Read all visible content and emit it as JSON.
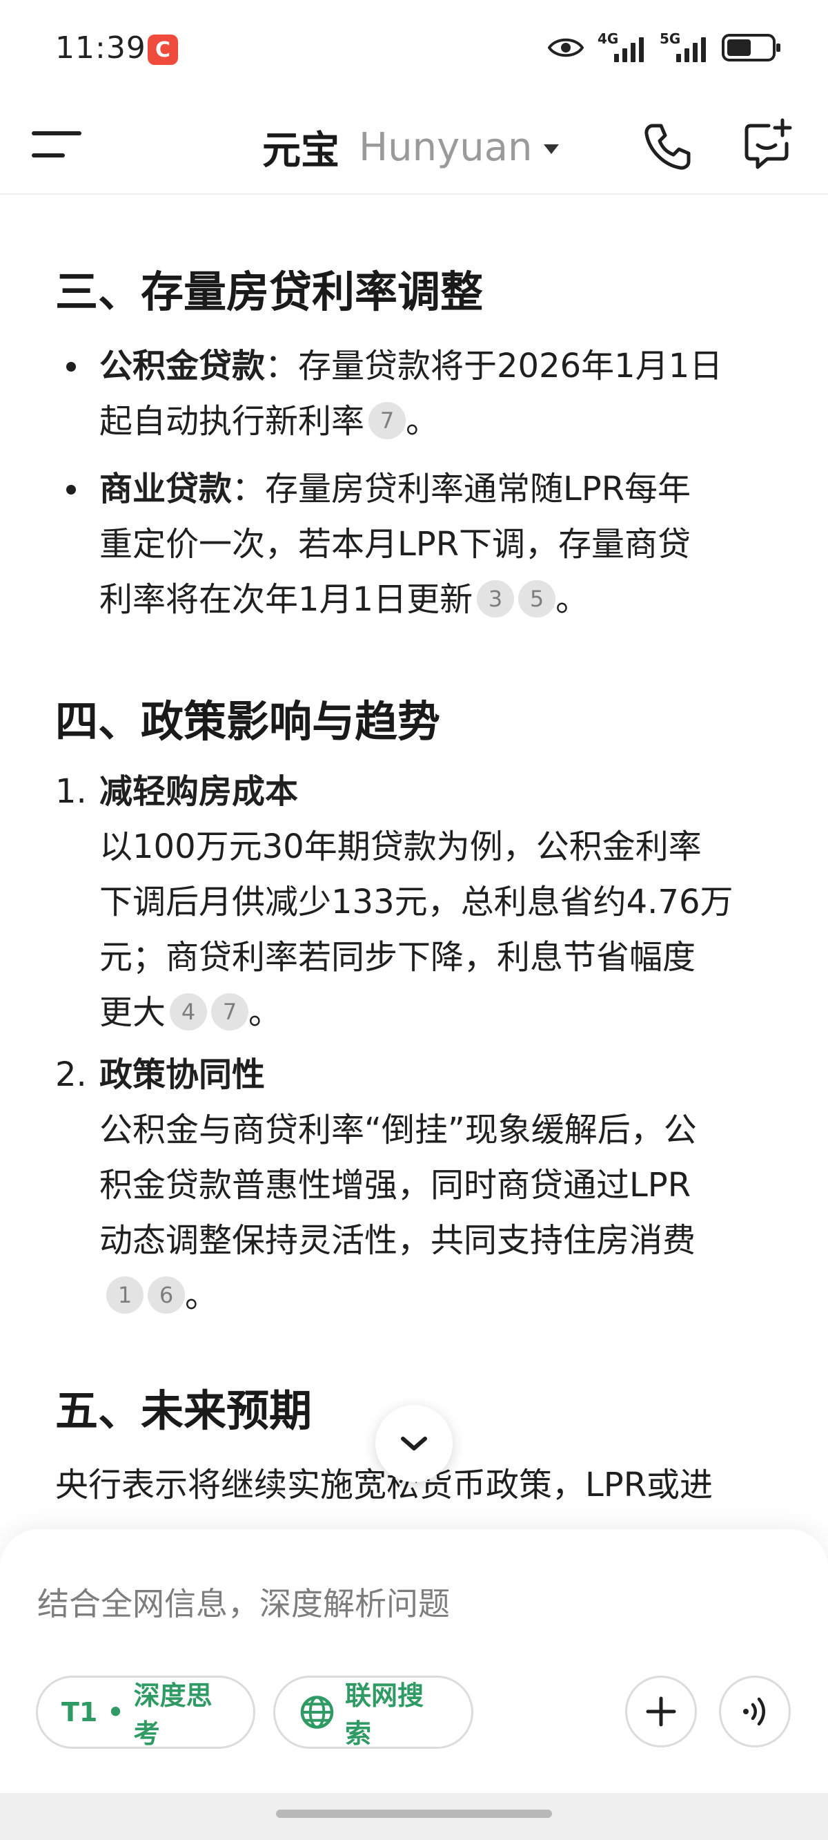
{
  "status_bar": {
    "time": "11:39",
    "app_badge": "C",
    "net1": "4G",
    "net2": "5G"
  },
  "header": {
    "brand": "元宝",
    "model": "Hunyuan"
  },
  "sections": {
    "s3": {
      "title": "三、存量房贷利率调整",
      "items": [
        {
          "label": "公积金贷款",
          "text1": "：存量贷款将于2026年1月1日",
          "text2": "起自动执行新利率",
          "cites": [
            "7"
          ],
          "end": "。"
        },
        {
          "label": "商业贷款",
          "text1": "：存量房贷利率通常随LPR每年",
          "text2": "重定价一次，若本月LPR下调，存量商贷",
          "text3": "利率将在次年1月1日更新",
          "cites": [
            "3",
            "5"
          ],
          "end": "。"
        }
      ]
    },
    "s4": {
      "title": "四、政策影响与趋势",
      "items": [
        {
          "num": "1.",
          "heading": "减轻购房成本",
          "lines": [
            "以100万元30年期贷款为例，公积金利率",
            "下调后月供减少133元，总利息省约4.76万",
            "元；商贷利率若同步下降，利息节省幅度",
            "更大"
          ],
          "cites": [
            "4",
            "7"
          ],
          "end": "。"
        },
        {
          "num": "2.",
          "heading": "政策协同性",
          "lines": [
            "公积金与商贷利率“倒挂”现象缓解后，公",
            "积金贷款普惠性增强，同时商贷通过LPR",
            "动态调整保持灵活性，共同支持住房消费"
          ],
          "cites": [
            "1",
            "6"
          ],
          "end": "。"
        }
      ]
    },
    "s5": {
      "title": "五、未来预期",
      "line1": "央行表示将继续实施宽松货币政策，LPR或进"
    }
  },
  "composer": {
    "placeholder": "结合全网信息，深度解析问题",
    "chip_think_model": "T1",
    "chip_think_dot": "•",
    "chip_think_label": "深度思考",
    "chip_search_label": "联网搜索"
  }
}
